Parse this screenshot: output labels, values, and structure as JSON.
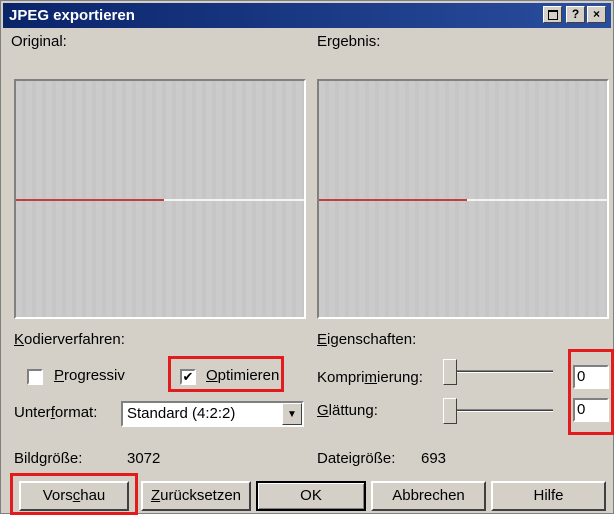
{
  "window": {
    "title": "JPEG exportieren",
    "controls": {
      "maximize_icon": "maximize-icon",
      "help": "?",
      "close": "×"
    }
  },
  "preview": {
    "original_label": "Original:",
    "result_label": "Ergebnis:"
  },
  "encoding": {
    "label": "Kodierverfahren:",
    "progressive": {
      "label": "Progressiv",
      "checked": false
    },
    "optimize": {
      "label": "Optimieren",
      "checked": true
    },
    "subformat_label": "Unterformat:",
    "subformat_value": "Standard (4:2:2)"
  },
  "properties": {
    "label": "Eigenschaften:",
    "compression_label": "Komprimierung:",
    "compression_value": "0",
    "smoothing_label": "Glättung:",
    "smoothing_value": "0"
  },
  "info": {
    "image_size_label": "Bildgröße:",
    "image_size_value": "3072",
    "file_size_label": "Dateigröße:",
    "file_size_value": "693"
  },
  "buttons": {
    "preview": "Vorschau",
    "reset": "Zurücksetzen",
    "ok": "OK",
    "cancel": "Abbrechen",
    "help": "Hilfe"
  },
  "colors": {
    "titlebar": "#0a246a",
    "highlight": "#e21c1c",
    "face": "#d4d0c8"
  }
}
